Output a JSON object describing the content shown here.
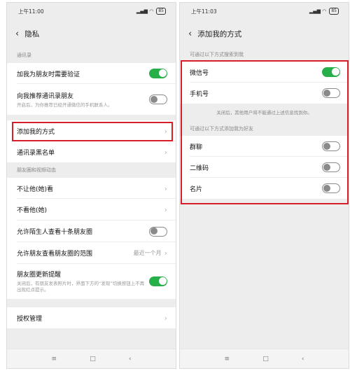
{
  "left": {
    "status_time": "上午11:00",
    "status_icons": "⌀ ☺ ∩",
    "battery": "85",
    "title": "隐私",
    "section_contacts": "通讯录",
    "verify_label": "加我为朋友时需要验证",
    "verify_on": true,
    "recommend_label": "向我推荐通讯录朋友",
    "recommend_sub": "开启后，为你推荐已经开通微信的手机联系人。",
    "recommend_on": false,
    "add_methods_label": "添加我的方式",
    "blacklist_label": "通讯录黑名单",
    "section_moments": "朋友圈和视频动态",
    "hide_from_label": "不让他(她)看",
    "not_see_label": "不看他(她)",
    "strangers_label": "允许陌生人查看十条朋友圈",
    "strangers_on": false,
    "range_label": "允许朋友查看朋友圈的范围",
    "range_value": "最近一个月",
    "update_label": "朋友圈更新提醒",
    "update_sub": "关闭后，有朋友发表照片时，界面下方的“发现”切换按钮上不再出现红点提示。",
    "update_on": true,
    "auth_label": "授权管理"
  },
  "right": {
    "status_time": "上午11:03",
    "status_icons": "⌀ ☺ ∩",
    "battery": "85",
    "title": "添加我的方式",
    "section_search": "可通过以下方式搜索到我",
    "wechat_id_label": "微信号",
    "wechat_id_on": true,
    "phone_label": "手机号",
    "phone_on": false,
    "hint": "关闭后，其他用户将不能通过上述信息找到你。",
    "section_add": "可通过以下方式添加我为好友",
    "group_label": "群聊",
    "group_on": false,
    "qr_label": "二维码",
    "qr_on": false,
    "card_label": "名片",
    "card_on": false
  },
  "nav": {
    "menu": "≡",
    "home": "□",
    "back": "‹"
  },
  "colors": {
    "toggle_on": "#27b04a",
    "highlight": "#d81e2a"
  }
}
